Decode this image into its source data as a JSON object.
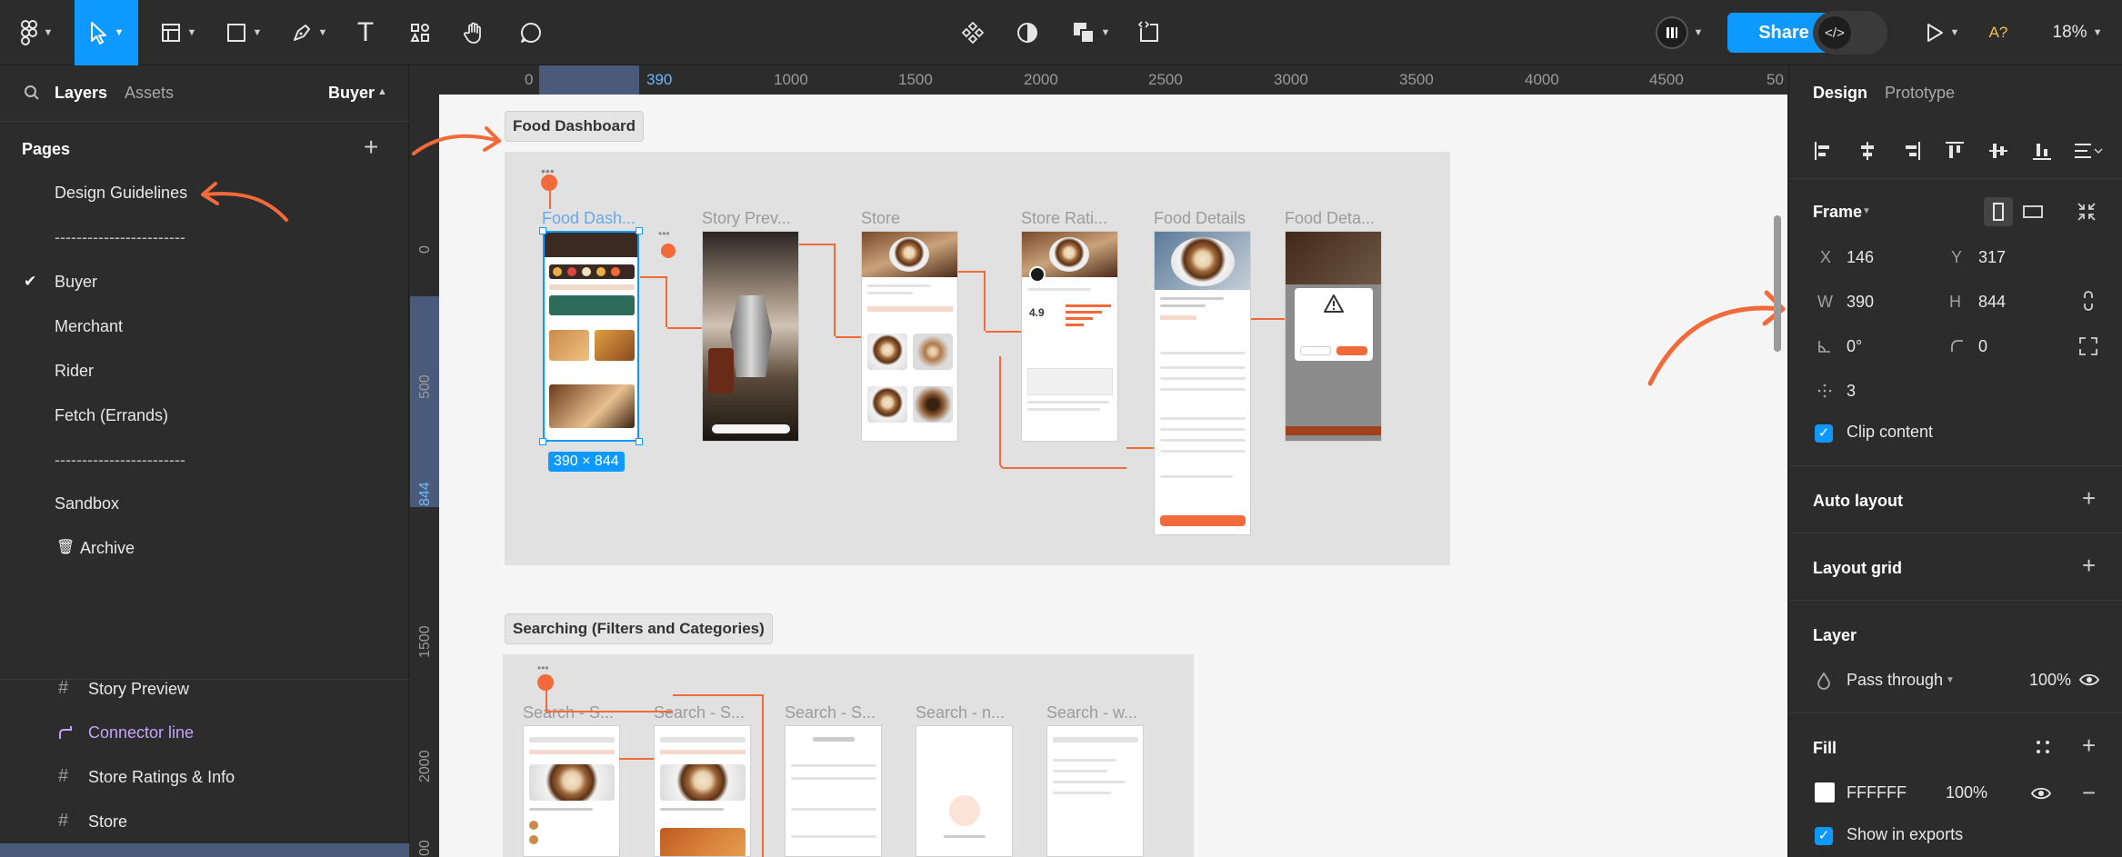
{
  "toolbar": {
    "zoom": "18%",
    "share_label": "Share",
    "user_initials": "A?"
  },
  "left": {
    "tabs": {
      "layers": "Layers",
      "assets": "Assets",
      "page_selector": "Buyer"
    },
    "pages_header": "Pages",
    "pages": [
      {
        "label": "Design Guidelines",
        "checked": false
      },
      {
        "label": "------------------------",
        "checked": false
      },
      {
        "label": "Buyer",
        "checked": true
      },
      {
        "label": "Merchant",
        "checked": false
      },
      {
        "label": "Rider",
        "checked": false
      },
      {
        "label": "Fetch (Errands)",
        "checked": false
      },
      {
        "label": "------------------------",
        "checked": false
      },
      {
        "label": "Sandbox",
        "checked": false
      },
      {
        "label": "Archive",
        "checked": false
      }
    ],
    "layers": [
      {
        "label": "Story Preview",
        "icon": "hash-icon"
      },
      {
        "label": "Connector line",
        "icon": "connector-icon"
      },
      {
        "label": "Store Ratings & Info",
        "icon": "hash-icon"
      },
      {
        "label": "Store",
        "icon": "hash-icon"
      }
    ]
  },
  "canvas": {
    "ruler_x": [
      "0",
      "390",
      "1000",
      "1500",
      "2000",
      "2500",
      "3000",
      "3500",
      "4000",
      "4500",
      "50"
    ],
    "ruler_y": [
      "0",
      "500",
      "844",
      "1500",
      "2000",
      "00"
    ],
    "section1": {
      "label": "Food Dashboard",
      "screens": [
        "Food Dash...",
        "Story Prev...",
        "Store",
        "Store Rati...",
        "Food Details",
        "Food Deta..."
      ],
      "size_badge": "390 × 844"
    },
    "section2": {
      "label": "Searching (Filters and Categories)",
      "screens": [
        "Search - S...",
        "Search - S...",
        "Search - S...",
        "Search - n...",
        "Search - w..."
      ]
    }
  },
  "right": {
    "tabs": {
      "design": "Design",
      "prototype": "Prototype"
    },
    "frame": {
      "header": "Frame",
      "x_label": "X",
      "x": "146",
      "y_label": "Y",
      "y": "317",
      "w_label": "W",
      "w": "390",
      "h_label": "H",
      "h": "844",
      "rotation": "0°",
      "radius": "0",
      "corner_smoothing": "3",
      "clip_content": "Clip content"
    },
    "auto_layout": "Auto layout",
    "layout_grid": "Layout grid",
    "layer": {
      "header": "Layer",
      "blend": "Pass through",
      "opacity": "100%"
    },
    "fill": {
      "header": "Fill",
      "hex": "FFFFFF",
      "opacity": "100%",
      "show_in_exports": "Show in exports"
    }
  },
  "colors": {
    "accent": "#0d99ff",
    "annotation": "#f26a3a",
    "panel": "#2c2c2c"
  }
}
